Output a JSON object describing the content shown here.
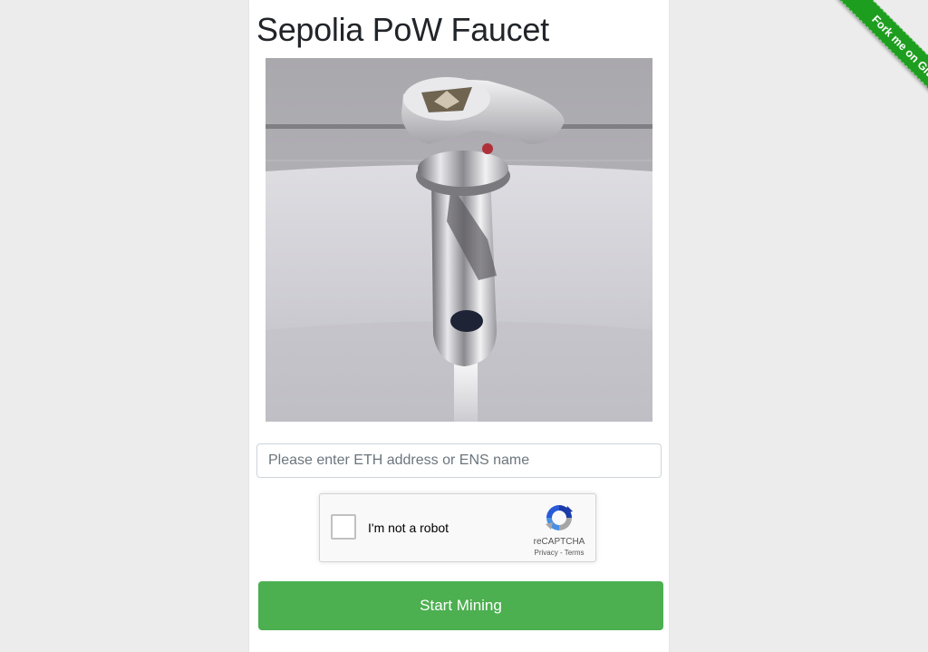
{
  "app": {
    "title": "Sepolia PoW Faucet"
  },
  "address_input": {
    "placeholder": "Please enter ETH address or ENS name",
    "value": ""
  },
  "captcha": {
    "checkbox_label": "I'm not a robot",
    "brand": "reCAPTCHA",
    "privacy_link": "Privacy",
    "separator": " - ",
    "terms_link": "Terms",
    "checked": false,
    "icon": "recaptcha-logo-icon"
  },
  "actions": {
    "start_label": "Start Mining"
  },
  "ribbon": {
    "label": "Fork me on GitHub"
  },
  "colors": {
    "primary_button": "#4caf50",
    "ribbon": "#1e9e1e",
    "page_background": "#ececec"
  },
  "image": {
    "icon": "ethereum-faucet-image"
  }
}
